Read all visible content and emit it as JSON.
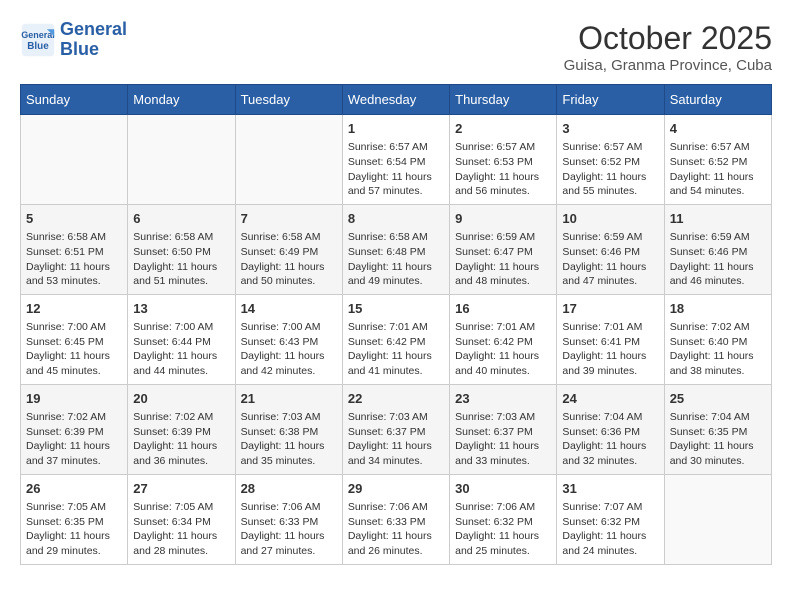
{
  "header": {
    "logo_line1": "General",
    "logo_line2": "Blue",
    "month": "October 2025",
    "location": "Guisa, Granma Province, Cuba"
  },
  "weekdays": [
    "Sunday",
    "Monday",
    "Tuesday",
    "Wednesday",
    "Thursday",
    "Friday",
    "Saturday"
  ],
  "weeks": [
    [
      {
        "day": "",
        "info": ""
      },
      {
        "day": "",
        "info": ""
      },
      {
        "day": "",
        "info": ""
      },
      {
        "day": "1",
        "info": "Sunrise: 6:57 AM\nSunset: 6:54 PM\nDaylight: 11 hours\nand 57 minutes."
      },
      {
        "day": "2",
        "info": "Sunrise: 6:57 AM\nSunset: 6:53 PM\nDaylight: 11 hours\nand 56 minutes."
      },
      {
        "day": "3",
        "info": "Sunrise: 6:57 AM\nSunset: 6:52 PM\nDaylight: 11 hours\nand 55 minutes."
      },
      {
        "day": "4",
        "info": "Sunrise: 6:57 AM\nSunset: 6:52 PM\nDaylight: 11 hours\nand 54 minutes."
      }
    ],
    [
      {
        "day": "5",
        "info": "Sunrise: 6:58 AM\nSunset: 6:51 PM\nDaylight: 11 hours\nand 53 minutes."
      },
      {
        "day": "6",
        "info": "Sunrise: 6:58 AM\nSunset: 6:50 PM\nDaylight: 11 hours\nand 51 minutes."
      },
      {
        "day": "7",
        "info": "Sunrise: 6:58 AM\nSunset: 6:49 PM\nDaylight: 11 hours\nand 50 minutes."
      },
      {
        "day": "8",
        "info": "Sunrise: 6:58 AM\nSunset: 6:48 PM\nDaylight: 11 hours\nand 49 minutes."
      },
      {
        "day": "9",
        "info": "Sunrise: 6:59 AM\nSunset: 6:47 PM\nDaylight: 11 hours\nand 48 minutes."
      },
      {
        "day": "10",
        "info": "Sunrise: 6:59 AM\nSunset: 6:46 PM\nDaylight: 11 hours\nand 47 minutes."
      },
      {
        "day": "11",
        "info": "Sunrise: 6:59 AM\nSunset: 6:46 PM\nDaylight: 11 hours\nand 46 minutes."
      }
    ],
    [
      {
        "day": "12",
        "info": "Sunrise: 7:00 AM\nSunset: 6:45 PM\nDaylight: 11 hours\nand 45 minutes."
      },
      {
        "day": "13",
        "info": "Sunrise: 7:00 AM\nSunset: 6:44 PM\nDaylight: 11 hours\nand 44 minutes."
      },
      {
        "day": "14",
        "info": "Sunrise: 7:00 AM\nSunset: 6:43 PM\nDaylight: 11 hours\nand 42 minutes."
      },
      {
        "day": "15",
        "info": "Sunrise: 7:01 AM\nSunset: 6:42 PM\nDaylight: 11 hours\nand 41 minutes."
      },
      {
        "day": "16",
        "info": "Sunrise: 7:01 AM\nSunset: 6:42 PM\nDaylight: 11 hours\nand 40 minutes."
      },
      {
        "day": "17",
        "info": "Sunrise: 7:01 AM\nSunset: 6:41 PM\nDaylight: 11 hours\nand 39 minutes."
      },
      {
        "day": "18",
        "info": "Sunrise: 7:02 AM\nSunset: 6:40 PM\nDaylight: 11 hours\nand 38 minutes."
      }
    ],
    [
      {
        "day": "19",
        "info": "Sunrise: 7:02 AM\nSunset: 6:39 PM\nDaylight: 11 hours\nand 37 minutes."
      },
      {
        "day": "20",
        "info": "Sunrise: 7:02 AM\nSunset: 6:39 PM\nDaylight: 11 hours\nand 36 minutes."
      },
      {
        "day": "21",
        "info": "Sunrise: 7:03 AM\nSunset: 6:38 PM\nDaylight: 11 hours\nand 35 minutes."
      },
      {
        "day": "22",
        "info": "Sunrise: 7:03 AM\nSunset: 6:37 PM\nDaylight: 11 hours\nand 34 minutes."
      },
      {
        "day": "23",
        "info": "Sunrise: 7:03 AM\nSunset: 6:37 PM\nDaylight: 11 hours\nand 33 minutes."
      },
      {
        "day": "24",
        "info": "Sunrise: 7:04 AM\nSunset: 6:36 PM\nDaylight: 11 hours\nand 32 minutes."
      },
      {
        "day": "25",
        "info": "Sunrise: 7:04 AM\nSunset: 6:35 PM\nDaylight: 11 hours\nand 30 minutes."
      }
    ],
    [
      {
        "day": "26",
        "info": "Sunrise: 7:05 AM\nSunset: 6:35 PM\nDaylight: 11 hours\nand 29 minutes."
      },
      {
        "day": "27",
        "info": "Sunrise: 7:05 AM\nSunset: 6:34 PM\nDaylight: 11 hours\nand 28 minutes."
      },
      {
        "day": "28",
        "info": "Sunrise: 7:06 AM\nSunset: 6:33 PM\nDaylight: 11 hours\nand 27 minutes."
      },
      {
        "day": "29",
        "info": "Sunrise: 7:06 AM\nSunset: 6:33 PM\nDaylight: 11 hours\nand 26 minutes."
      },
      {
        "day": "30",
        "info": "Sunrise: 7:06 AM\nSunset: 6:32 PM\nDaylight: 11 hours\nand 25 minutes."
      },
      {
        "day": "31",
        "info": "Sunrise: 7:07 AM\nSunset: 6:32 PM\nDaylight: 11 hours\nand 24 minutes."
      },
      {
        "day": "",
        "info": ""
      }
    ]
  ]
}
